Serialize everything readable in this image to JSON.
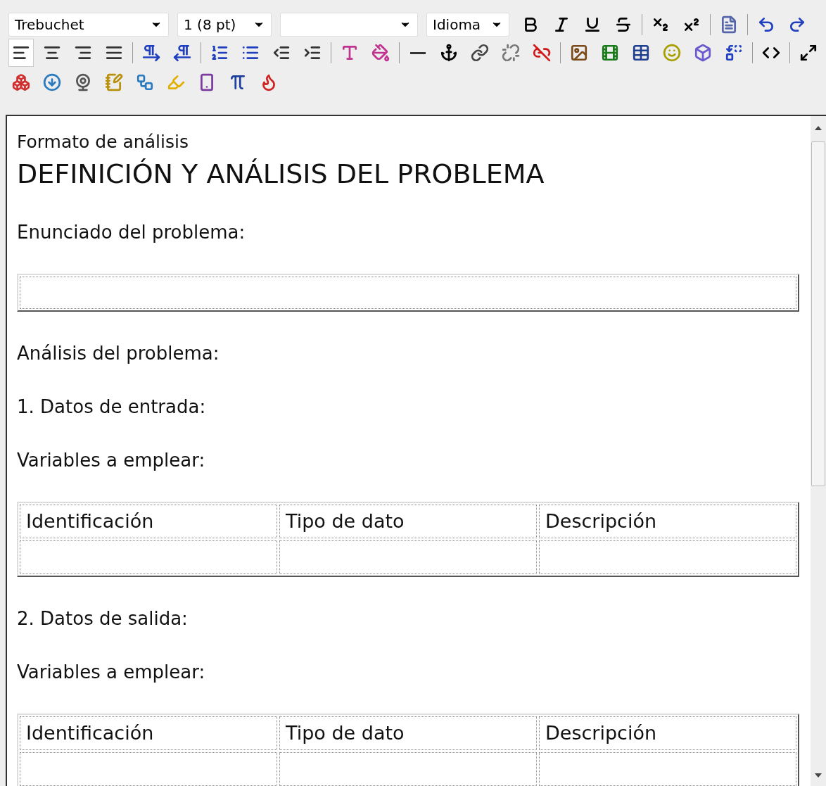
{
  "toolbar": {
    "selects": [
      {
        "kind": "font",
        "value": "Trebuchet"
      },
      {
        "kind": "size",
        "value": "1 (8 pt)"
      },
      {
        "kind": "format"
      },
      {
        "kind": "language",
        "value": "Idioma"
      }
    ],
    "rows": [
      [
        {
          "kind": "bold"
        },
        {
          "kind": "italic"
        },
        {
          "kind": "underline"
        },
        {
          "kind": "strike"
        },
        {
          "kind": "separator"
        },
        {
          "kind": "subscript"
        },
        {
          "kind": "superscript"
        },
        {
          "kind": "separator"
        },
        {
          "kind": "paste-word"
        },
        {
          "kind": "separator"
        },
        {
          "kind": "undo"
        },
        {
          "kind": "redo"
        }
      ],
      [
        {
          "kind": "align-left",
          "selected": true
        },
        {
          "kind": "align-center",
          "selected": false
        },
        {
          "kind": "align-right",
          "selected": false
        },
        {
          "kind": "align-justify",
          "selected": false
        },
        {
          "kind": "separator"
        },
        {
          "kind": "ltr",
          "selected": false
        },
        {
          "kind": "rtl",
          "selected": false
        },
        {
          "kind": "separator"
        },
        {
          "kind": "ordered-list",
          "selected": false
        },
        {
          "kind": "bullet-list",
          "selected": false
        },
        {
          "kind": "outdent",
          "selected": false
        },
        {
          "kind": "indent",
          "selected": false
        },
        {
          "kind": "separator"
        },
        {
          "kind": "text-color",
          "selected": false
        },
        {
          "kind": "back-color",
          "selected": false
        },
        {
          "kind": "separator"
        },
        {
          "kind": "rule",
          "selected": false
        },
        {
          "kind": "anchor",
          "selected": false
        },
        {
          "kind": "link",
          "selected": false
        },
        {
          "kind": "unlink",
          "selected": false
        },
        {
          "kind": "nolink",
          "selected": false
        },
        {
          "kind": "separator"
        },
        {
          "kind": "image",
          "selected": false
        },
        {
          "kind": "media",
          "selected": false
        },
        {
          "kind": "table",
          "selected": false
        },
        {
          "kind": "smiley",
          "selected": false
        },
        {
          "kind": "char",
          "selected": false
        },
        {
          "kind": "replace",
          "selected": false
        },
        {
          "kind": "separator"
        },
        {
          "kind": "html",
          "selected": false
        },
        {
          "kind": "separator"
        },
        {
          "kind": "fullscreen",
          "selected": false
        }
      ],
      [
        {
          "kind": "blocks"
        },
        {
          "kind": "download"
        },
        {
          "kind": "webcam"
        },
        {
          "kind": "note"
        },
        {
          "kind": "diagram"
        },
        {
          "kind": "highlighter"
        },
        {
          "kind": "phone"
        },
        {
          "kind": "pi"
        },
        {
          "kind": "flash"
        }
      ]
    ]
  },
  "document": [
    {
      "kind": "caption",
      "text": "Formato de análisis"
    },
    {
      "kind": "heading",
      "text": "DEFINICIÓN Y ANÁLISIS DEL PROBLEMA"
    },
    {
      "kind": "paragraph",
      "text": "Enunciado del problema:"
    },
    {
      "kind": "table"
    },
    {
      "kind": "paragraph",
      "text": "Análisis del problema:"
    },
    {
      "kind": "paragraph",
      "text": "1. Datos de entrada:"
    },
    {
      "kind": "paragraph",
      "text": "Variables a emplear:"
    },
    {
      "kind": "table",
      "columns": [
        "Identificación",
        "Tipo de dato",
        "Descripción"
      ]
    },
    {
      "kind": "paragraph",
      "text": "2. Datos de salida:"
    },
    {
      "kind": "paragraph",
      "text": "Variables a emplear:"
    },
    {
      "kind": "table",
      "columns": [
        "Identificación",
        "Tipo de dato",
        "Descripción"
      ]
    }
  ]
}
